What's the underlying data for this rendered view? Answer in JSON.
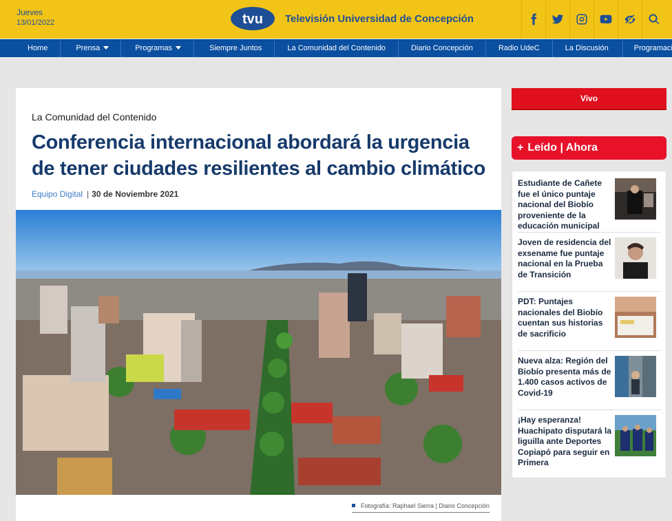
{
  "header": {
    "day": "Jueves",
    "date": "13/01/2022",
    "logo_text": "tvu",
    "brand": "Televisión Universidad de Concepción",
    "social_icons": [
      "facebook-icon",
      "twitter-icon",
      "instagram-icon",
      "youtube-icon",
      "accessibility-icon",
      "search-icon"
    ],
    "colors": {
      "bar": "#f2c418",
      "brand": "#1e4e96"
    }
  },
  "nav": {
    "items": [
      {
        "label": "Home"
      },
      {
        "label": "Prensa"
      },
      {
        "label": "Programas"
      },
      {
        "label": "Siempre Juntos"
      },
      {
        "label": "La Comunidad del Contenido"
      },
      {
        "label": "Diario Concepción"
      },
      {
        "label": "Radio UdeC"
      },
      {
        "label": "La Discusión"
      },
      {
        "label": "Programación"
      }
    ]
  },
  "article": {
    "category": "La Comunidad del Contenido",
    "headline": "Conferencia internacional abordará la urgencia de tener ciudades resilientes al cambio climático",
    "author": "Equipo Digital",
    "separator": "|",
    "date": "30 de Noviembre 2021",
    "caption": "Fotografía: Raphael Sierra | Diario Concepción"
  },
  "sidebar": {
    "vivo": "Vivo",
    "leido_plus": "+",
    "leido_title": "Leído | Ahora",
    "items": [
      {
        "title": "Estudiante de Cañete fue el único puntaje nacional del Biobío proveniente de la educación municipal"
      },
      {
        "title": "Joven de residencia del exsename fue puntaje nacional en la Prueba de Transición"
      },
      {
        "title": "PDT: Puntajes nacionales del Biobío cuentan sus historias de sacrificio"
      },
      {
        "title": "Nueva alza: Región del Biobío presenta más de 1.400 casos activos de Covid-19"
      },
      {
        "title": "¡Hay esperanza! Huachipato disputará la liguilla ante Deportes Copiapó para seguir en Primera"
      }
    ]
  }
}
